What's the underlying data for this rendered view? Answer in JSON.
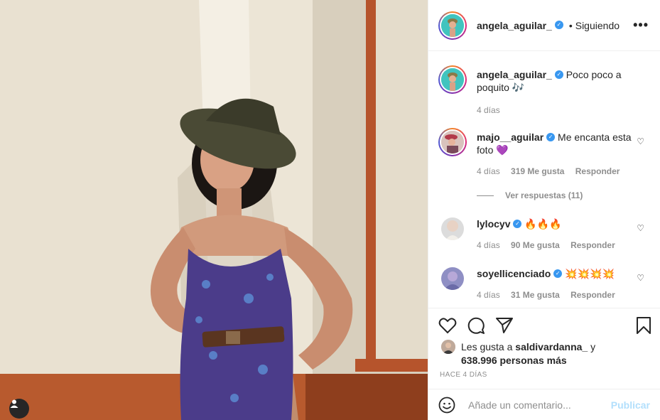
{
  "header": {
    "username": "angela_aguilar_",
    "separator": "•",
    "follow_state": "Siguiendo",
    "more": "•••"
  },
  "caption": {
    "username": "angela_aguilar_",
    "text": "Poco poco a poquito",
    "emoji": "🎶",
    "time": "4 días"
  },
  "comments": [
    {
      "username": "majo__aguilar",
      "verified": true,
      "text": "Me encanta esta foto",
      "emoji": "💜",
      "time": "4 días",
      "likes": "319 Me gusta",
      "reply": "Responder"
    },
    {
      "username": "lylocyv",
      "verified": true,
      "text": "",
      "emoji": "🔥🔥🔥",
      "time": "4 días",
      "likes": "90 Me gusta",
      "reply": "Responder"
    },
    {
      "username": "soyellicenciado",
      "verified": true,
      "text": "",
      "emoji": "💥💥💥💥",
      "time": "4 días",
      "likes": "31 Me gusta",
      "reply": "Responder"
    }
  ],
  "view_replies": "Ver respuestas (11)",
  "likes": {
    "prefix": "Les gusta a",
    "user": "saldivardanna_",
    "conj": "y",
    "count": "638.996 personas más"
  },
  "timestamp": "HACE 4 DÍAS",
  "add_comment": {
    "placeholder": "Añade un comentario...",
    "publish": "Publicar"
  },
  "colors": {
    "verified": "#3897f0",
    "publish_disabled": "#b2dffc",
    "muted": "#8e8e8e"
  }
}
